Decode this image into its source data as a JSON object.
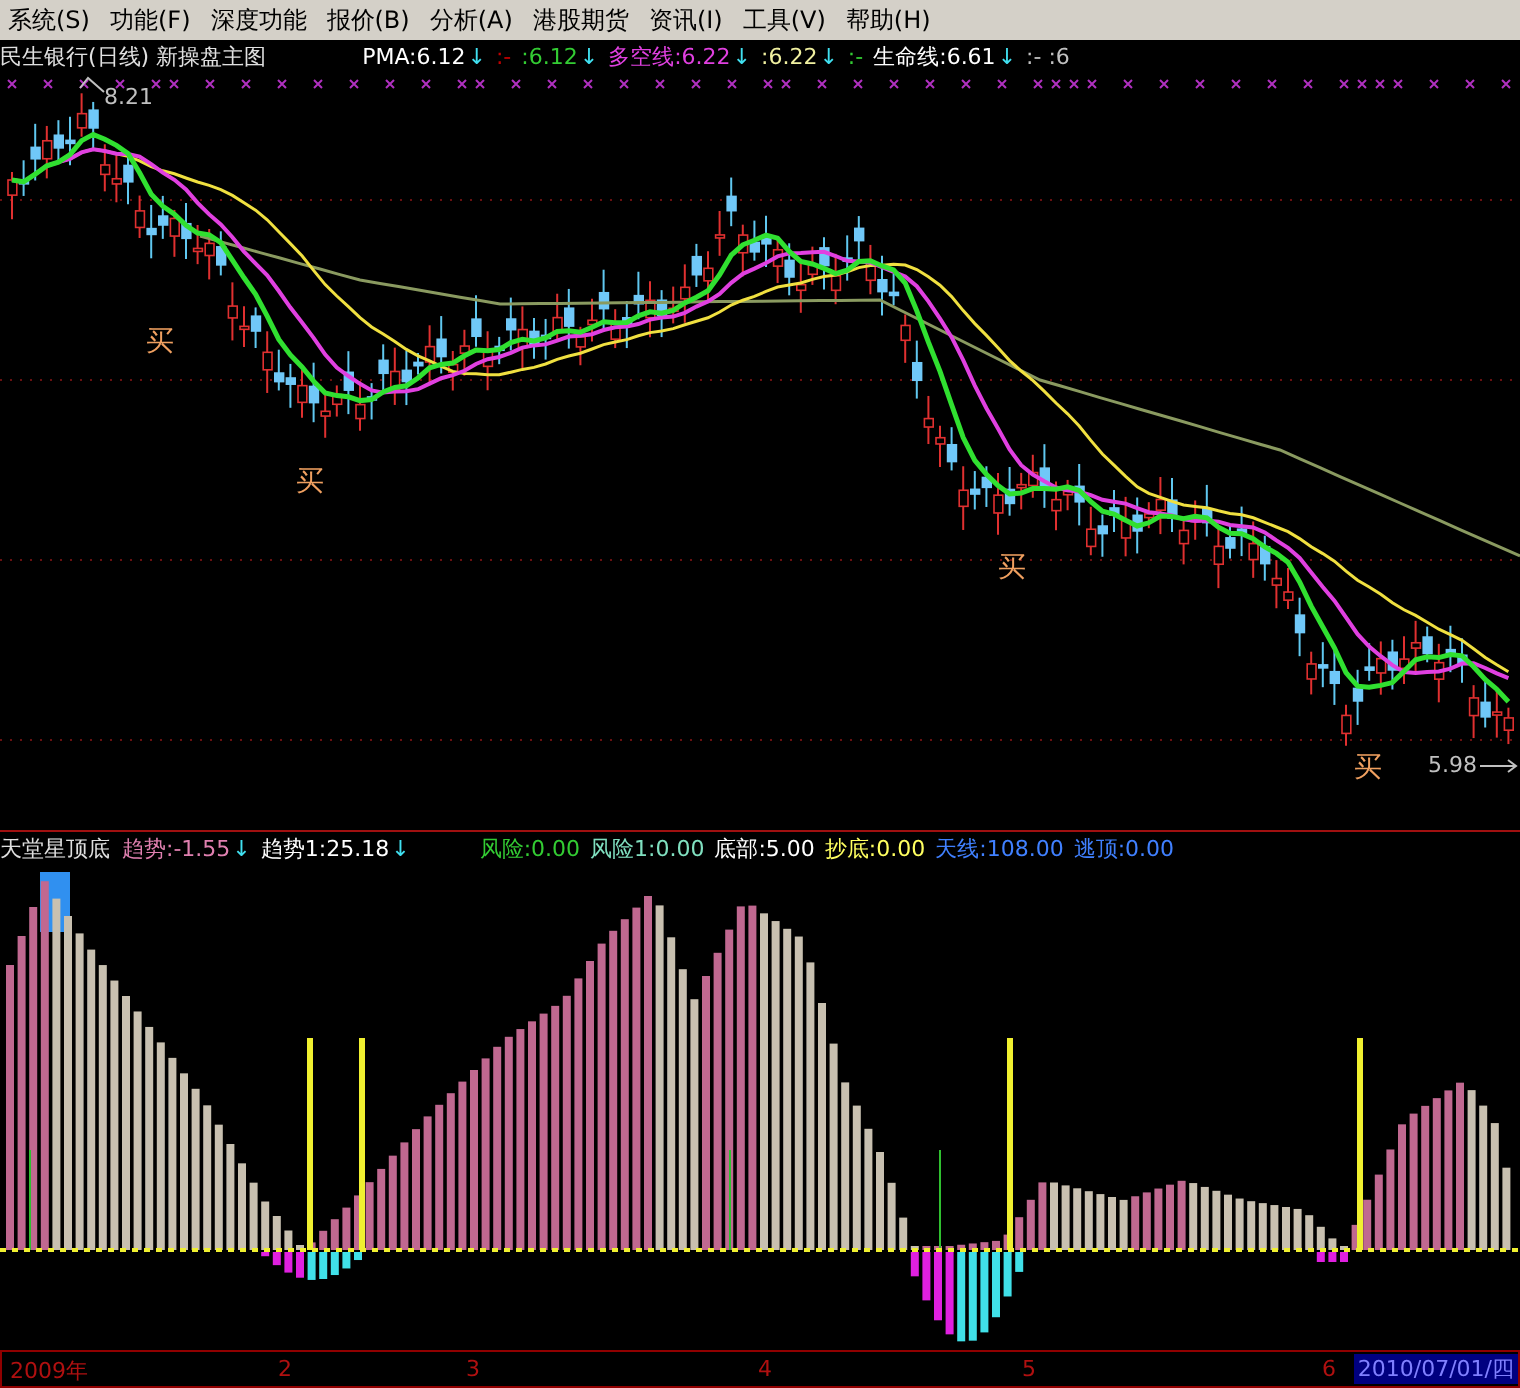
{
  "menu": [
    "系统(S)",
    "功能(F)",
    "深度功能",
    "报价(B)",
    "分析(A)",
    "港股期货",
    "资讯(I)",
    "工具(V)",
    "帮助(H)"
  ],
  "main_chart": {
    "title": "民生银行(日线) 新操盘主图",
    "indicators": [
      {
        "text": "PMA:6.12",
        "color": "#ffffff",
        "arrow": "↓"
      },
      {
        "text": ":-",
        "color": "#c00000"
      },
      {
        "text": ":6.12",
        "color": "#33cc33",
        "arrow": "↓"
      },
      {
        "text": "多空线:6.22",
        "color": "#e040e0",
        "arrow": "↓"
      },
      {
        "text": ":6.22",
        "color": "#f0f0a0",
        "arrow": "↓"
      },
      {
        "text": ":-",
        "color": "#33cc33"
      },
      {
        "text": "生命线:6.61",
        "color": "#ffffff",
        "arrow": "↓"
      },
      {
        "text": ":- :6",
        "color": "#c0c0c0"
      }
    ],
    "high_label": "8.21",
    "last_price_label": "5.98",
    "buy_signals": [
      "买",
      "买",
      "买",
      "买"
    ]
  },
  "indicator_chart": {
    "title": "天堂星顶底",
    "values": [
      {
        "text": "趋势:-1.55",
        "color": "#e080b0",
        "arrow": "↓"
      },
      {
        "text": "趋势1:25.18",
        "color": "#ffffff",
        "arrow": "↓"
      },
      {
        "text": "风险:0.00",
        "color": "#33cc33"
      },
      {
        "text": "风险1:0.00",
        "color": "#80e0c0"
      },
      {
        "text": "底部:5.00",
        "color": "#ffffff"
      },
      {
        "text": "抄底:0.00",
        "color": "#ffff60"
      },
      {
        "text": "天线:108.00",
        "color": "#4080ff"
      },
      {
        "text": "逃顶:0.00",
        "color": "#4080ff"
      }
    ]
  },
  "x_axis": {
    "labels": [
      "2009年",
      "2",
      "3",
      "4",
      "5",
      "6"
    ],
    "cursor_date": "2010/07/01/四"
  }
}
